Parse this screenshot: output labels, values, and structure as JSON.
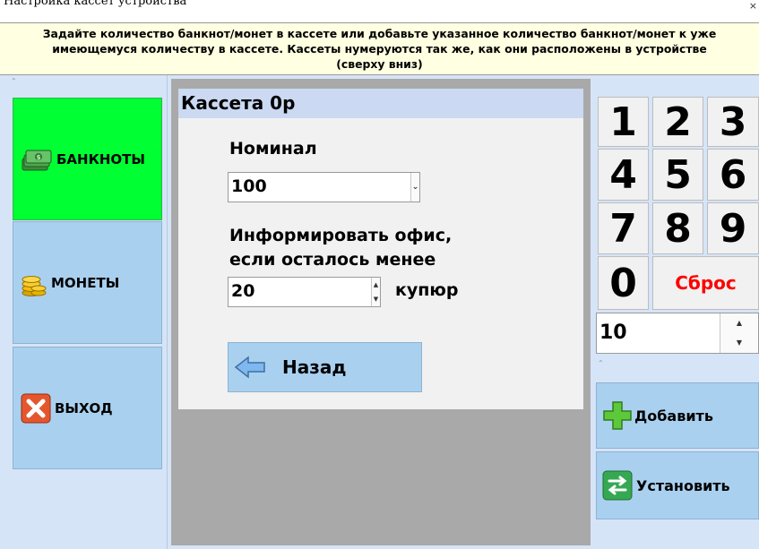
{
  "window": {
    "title": "Настройка кассет устройства",
    "close_glyph": "×"
  },
  "banner": {
    "text_line1": "Задайте количество банкнот/монет в кассете или добавьте указанное количество банкнот/монет к уже",
    "text_line2": "имеющемуся количеству в кассете. Кассеты нумеруются так же, как они расположены в устройстве",
    "text_line3": "(сверху вниз)"
  },
  "sidebar": {
    "items": [
      {
        "label": "БАНКНОТЫ",
        "icon": "banknotes-icon",
        "active": true
      },
      {
        "label": "МОНЕТЫ",
        "icon": "coins-icon",
        "active": false
      },
      {
        "label": "ВЫХОД",
        "icon": "exit-x-icon",
        "active": false
      }
    ]
  },
  "cassette": {
    "title": "Кассета 0р",
    "denomination_label": "Номинал",
    "denomination_value": "100",
    "inform_label_line1": "Информировать офис,",
    "inform_label_line2": "если осталось менее",
    "threshold_value": "20",
    "unit_label": "купюр",
    "back_label": "Назад"
  },
  "keypad": {
    "keys": [
      "1",
      "2",
      "3",
      "4",
      "5",
      "6",
      "7",
      "8",
      "9",
      "0"
    ],
    "reset_label": "Сброс",
    "amount_value": "10"
  },
  "actions": {
    "add_label": "Добавить",
    "set_label": "Установить"
  },
  "colors": {
    "active_green": "#00ff33",
    "button_blue": "#a9d0ef",
    "pane_blue": "#d6e4f7",
    "banner_yellow": "#ffffe1",
    "reset_red": "#ff0000"
  }
}
